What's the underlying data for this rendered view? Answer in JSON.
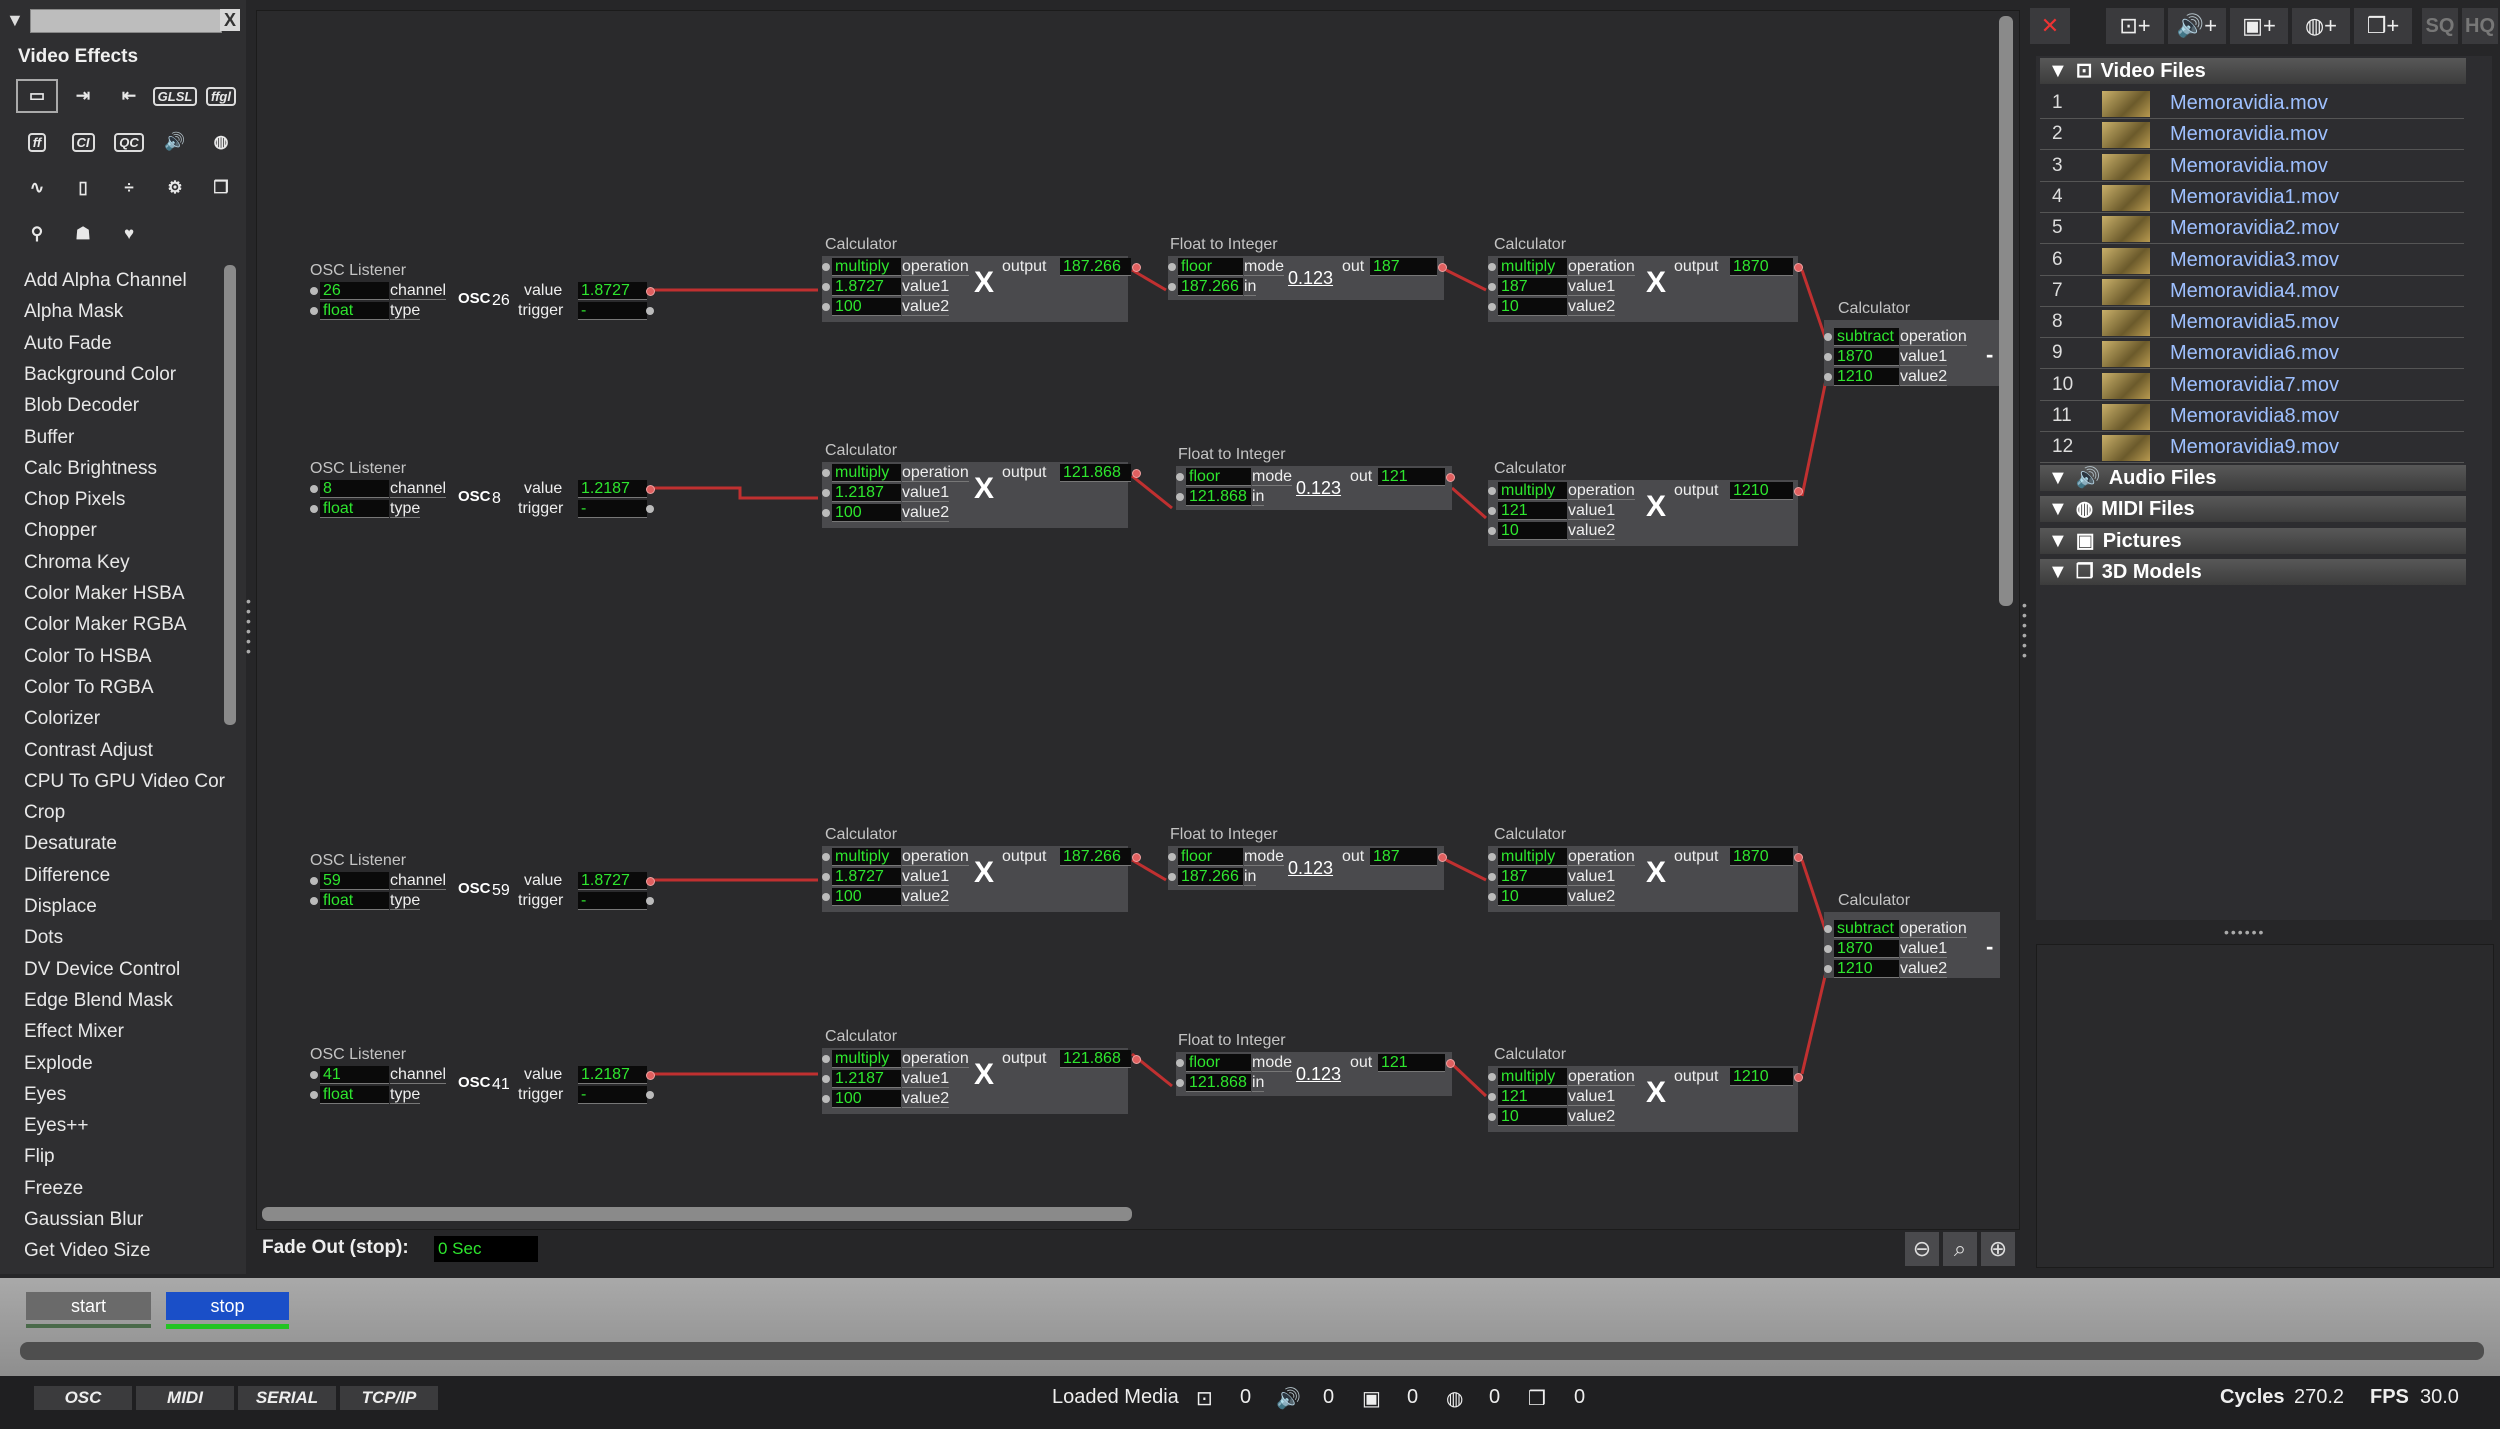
{
  "left": {
    "category_title": "Video Effects",
    "category_icons": [
      {
        "name": "video-effects-icon",
        "glyph": "▭"
      },
      {
        "name": "video-in-icon",
        "glyph": "⇥"
      },
      {
        "name": "video-out-icon",
        "glyph": "⇤"
      },
      {
        "name": "glsl-icon",
        "glyph": "GLSL"
      },
      {
        "name": "ffgl-icon",
        "glyph": "ffgl"
      },
      {
        "name": "freeframe-icon",
        "glyph": "ff"
      },
      {
        "name": "core-image-icon",
        "glyph": "CI"
      },
      {
        "name": "quartz-composer-icon",
        "glyph": "QC"
      },
      {
        "name": "audio-icon",
        "glyph": "🔊"
      },
      {
        "name": "midi-icon",
        "glyph": "◍"
      },
      {
        "name": "wave-icon",
        "glyph": "∿"
      },
      {
        "name": "mouse-icon",
        "glyph": "▯"
      },
      {
        "name": "math-icon",
        "glyph": "÷"
      },
      {
        "name": "gear-icon",
        "glyph": "⚙"
      },
      {
        "name": "scene-icon",
        "glyph": "❐"
      },
      {
        "name": "broadcast-icon",
        "glyph": "⚲"
      },
      {
        "name": "user-icon",
        "glyph": "☗"
      },
      {
        "name": "heart-icon",
        "glyph": "♥"
      }
    ],
    "actors": [
      "Add Alpha Channel",
      "Alpha Mask",
      "Auto Fade",
      "Background Color",
      "Blob Decoder",
      "Buffer",
      "Calc Brightness",
      "Chop Pixels",
      "Chopper",
      "Chroma Key",
      "Color Maker HSBA",
      "Color Maker RGBA",
      "Color To HSBA",
      "Color To RGBA",
      "Colorizer",
      "Contrast Adjust",
      "CPU To GPU Video Cor",
      "Crop",
      "Desaturate",
      "Difference",
      "Displace",
      "Dots",
      "DV Device Control",
      "Edge Blend Mask",
      "Effect Mixer",
      "Explode",
      "Eyes",
      "Eyes++",
      "Flip",
      "Freeze",
      "Gaussian Blur",
      "Get Video Size"
    ]
  },
  "labels": {
    "osc_title": "OSC Listener",
    "calc_title": "Calculator",
    "f2i_title": "Float to Integer",
    "channel": "channel",
    "type": "type",
    "value": "value",
    "trigger": "trigger",
    "operation": "operation",
    "value1": "value1",
    "value2": "value2",
    "output": "output",
    "mode": "mode",
    "in": "in",
    "out": "out",
    "osc": "OSC",
    "x": "X",
    "mode_num": "0.123",
    "minus": "-"
  },
  "rows": [
    {
      "osc": {
        "channel": "26",
        "type": "float",
        "value": "1.8727",
        "trigger": "-",
        "num": "26"
      },
      "calc1": {
        "op": "multiply",
        "v1": "1.8727",
        "v2": "100",
        "out": "187.266"
      },
      "f2i": {
        "mode": "floor",
        "in": "187.266",
        "out": "187"
      },
      "calc2": {
        "op": "multiply",
        "v1": "187",
        "v2": "10",
        "out": "1870"
      }
    },
    {
      "osc": {
        "channel": "8",
        "type": "float",
        "value": "1.2187",
        "trigger": "-",
        "num": "8"
      },
      "calc1": {
        "op": "multiply",
        "v1": "1.2187",
        "v2": "100",
        "out": "121.868"
      },
      "f2i": {
        "mode": "floor",
        "in": "121.868",
        "out": "121"
      },
      "calc2": {
        "op": "multiply",
        "v1": "121",
        "v2": "10",
        "out": "1210"
      }
    },
    {
      "osc": {
        "channel": "59",
        "type": "float",
        "value": "1.8727",
        "trigger": "-",
        "num": "59"
      },
      "calc1": {
        "op": "multiply",
        "v1": "1.8727",
        "v2": "100",
        "out": "187.266"
      },
      "f2i": {
        "mode": "floor",
        "in": "187.266",
        "out": "187"
      },
      "calc2": {
        "op": "multiply",
        "v1": "187",
        "v2": "10",
        "out": "1870"
      }
    },
    {
      "osc": {
        "channel": "41",
        "type": "float",
        "value": "1.2187",
        "trigger": "-",
        "num": "41"
      },
      "calc1": {
        "op": "multiply",
        "v1": "1.2187",
        "v2": "100",
        "out": "121.868"
      },
      "f2i": {
        "mode": "floor",
        "in": "121.868",
        "out": "121"
      },
      "calc2": {
        "op": "multiply",
        "v1": "121",
        "v2": "10",
        "out": "1210"
      }
    }
  ],
  "subtractors": [
    {
      "op": "subtract",
      "v1": "1870",
      "v2": "1210"
    },
    {
      "op": "subtract",
      "v1": "1870",
      "v2": "1210"
    }
  ],
  "toolbar": {
    "sq": "SQ",
    "hq": "HQ"
  },
  "media": {
    "video_header": "Video Files",
    "videos": [
      {
        "num": "1",
        "name": "Memoravidia.mov"
      },
      {
        "num": "2",
        "name": "Memoravidia.mov"
      },
      {
        "num": "3",
        "name": "Memoravidia.mov"
      },
      {
        "num": "4",
        "name": "Memoravidia1.mov"
      },
      {
        "num": "5",
        "name": "Memoravidia2.mov"
      },
      {
        "num": "6",
        "name": "Memoravidia3.mov"
      },
      {
        "num": "7",
        "name": "Memoravidia4.mov"
      },
      {
        "num": "8",
        "name": "Memoravidia5.mov"
      },
      {
        "num": "9",
        "name": "Memoravidia6.mov"
      },
      {
        "num": "10",
        "name": "Memoravidia7.mov"
      },
      {
        "num": "11",
        "name": "Memoravidia8.mov"
      },
      {
        "num": "12",
        "name": "Memoravidia9.mov"
      }
    ],
    "other_headers": [
      "Audio Files",
      "MIDI Files",
      "Pictures",
      "3D Models"
    ]
  },
  "fade": {
    "label": "Fade Out (stop):",
    "value": "0 Sec"
  },
  "scenes": {
    "start": "start",
    "stop": "stop"
  },
  "status": {
    "comm": [
      "OSC",
      "MIDI",
      "SERIAL",
      "TCP/IP"
    ],
    "loaded_media": "Loaded Media",
    "counts": {
      "video": "0",
      "audio": "0",
      "picture": "0",
      "midi": "0",
      "model": "0"
    },
    "cycles_label": "Cycles",
    "cycles": "270.2",
    "fps_label": "FPS",
    "fps": "30.0"
  },
  "colors": {
    "value_green": "#2ee52e",
    "link_red": "#c03030",
    "stop_blue": "#1a4fc8",
    "media_link": "#9ec0ff"
  }
}
